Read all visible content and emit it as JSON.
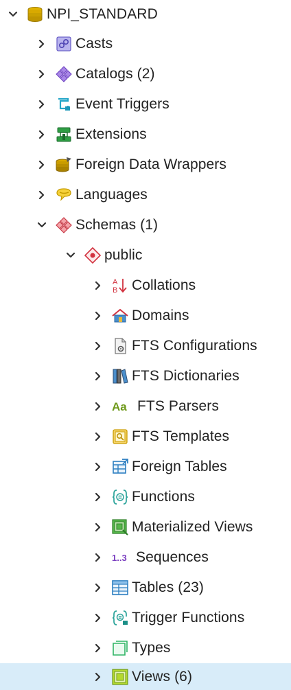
{
  "tree": {
    "rows": [
      {
        "label": "NPI_STANDARD",
        "icon": "database-icon",
        "expanded": true,
        "level": 0
      },
      {
        "label": "Casts",
        "icon": "casts-icon",
        "expanded": false,
        "level": 1
      },
      {
        "label": "Catalogs (2)",
        "icon": "catalogs-icon",
        "expanded": false,
        "level": 1
      },
      {
        "label": "Event Triggers",
        "icon": "event-triggers-icon",
        "expanded": false,
        "level": 1
      },
      {
        "label": "Extensions",
        "icon": "extensions-icon",
        "expanded": false,
        "level": 1
      },
      {
        "label": "Foreign Data Wrappers",
        "icon": "foreign-data-wrappers-icon",
        "expanded": false,
        "level": 1
      },
      {
        "label": "Languages",
        "icon": "languages-icon",
        "expanded": false,
        "level": 1
      },
      {
        "label": "Schemas (1)",
        "icon": "schemas-icon",
        "expanded": true,
        "level": 1
      },
      {
        "label": "public",
        "icon": "schema-public-icon",
        "expanded": true,
        "level": 2
      },
      {
        "label": "Collations",
        "icon": "collations-icon",
        "expanded": false,
        "level": 3
      },
      {
        "label": "Domains",
        "icon": "domains-icon",
        "expanded": false,
        "level": 3
      },
      {
        "label": "FTS Configurations",
        "icon": "fts-configurations-icon",
        "expanded": false,
        "level": 3
      },
      {
        "label": "FTS Dictionaries",
        "icon": "fts-dictionaries-icon",
        "expanded": false,
        "level": 3
      },
      {
        "label": "FTS Parsers",
        "icon": "fts-parsers-icon",
        "expanded": false,
        "level": 3
      },
      {
        "label": "FTS Templates",
        "icon": "fts-templates-icon",
        "expanded": false,
        "level": 3
      },
      {
        "label": "Foreign Tables",
        "icon": "foreign-tables-icon",
        "expanded": false,
        "level": 3
      },
      {
        "label": "Functions",
        "icon": "functions-icon",
        "expanded": false,
        "level": 3
      },
      {
        "label": "Materialized Views",
        "icon": "materialized-views-icon",
        "expanded": false,
        "level": 3
      },
      {
        "label": "Sequences",
        "icon": "sequences-icon",
        "expanded": false,
        "level": 3
      },
      {
        "label": "Tables (23)",
        "icon": "tables-icon",
        "expanded": false,
        "level": 3
      },
      {
        "label": "Trigger Functions",
        "icon": "trigger-functions-icon",
        "expanded": false,
        "level": 3
      },
      {
        "label": "Types",
        "icon": "types-icon",
        "expanded": false,
        "level": 3
      },
      {
        "label": "Views (6)",
        "icon": "views-icon",
        "expanded": false,
        "level": 3,
        "selected": true
      }
    ],
    "colors": {
      "selected_background": "#d8ecf9",
      "text": "#222222",
      "chevron": "#333333"
    }
  },
  "icon_text": {
    "fts_parsers": "Aa",
    "sequences": "1..3",
    "collations_top": "A",
    "collations_bottom": "B"
  }
}
